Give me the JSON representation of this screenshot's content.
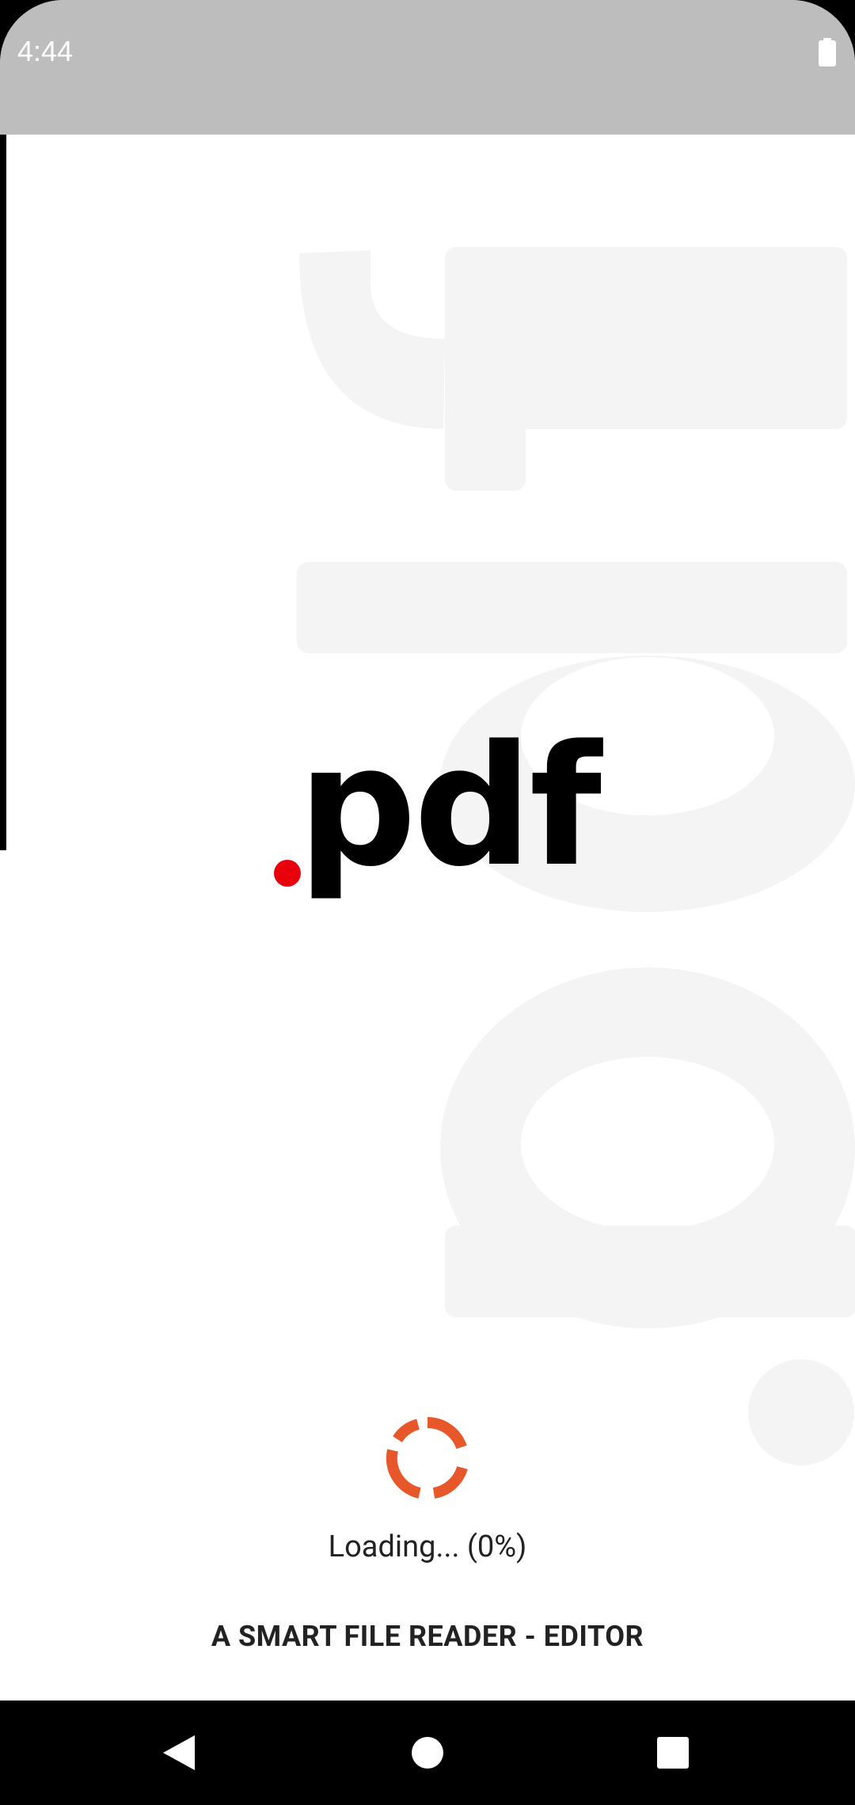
{
  "status_bar": {
    "time": "4:44",
    "battery_icon": "battery-icon"
  },
  "logo": {
    "text": "pdf",
    "dot_color": "#e8000b",
    "watermark_text": "pdf"
  },
  "loading": {
    "text": "Loading... (0%)",
    "progress_percent": 0,
    "spinner_color": "#e8572a"
  },
  "tagline": "A SMART FILE READER - EDITOR",
  "nav_bar": {
    "back_icon": "back-triangle-icon",
    "home_icon": "home-circle-icon",
    "recent_icon": "recent-square-icon"
  }
}
